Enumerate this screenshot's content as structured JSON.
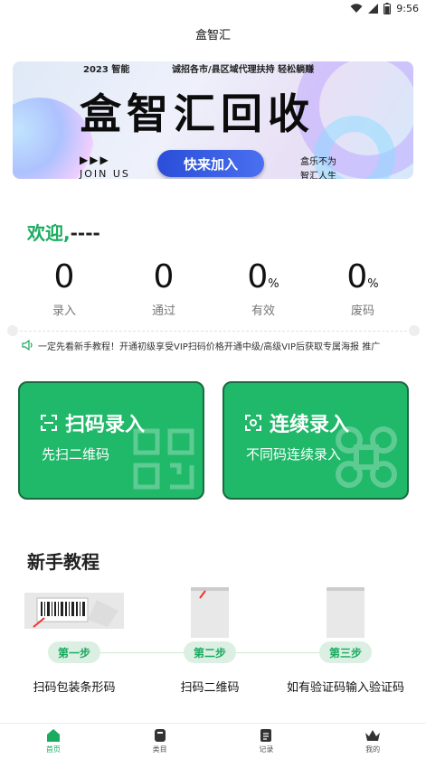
{
  "status": {
    "time": "9:56"
  },
  "header": {
    "title": "盒智汇"
  },
  "banner": {
    "year": "2023",
    "brand_small": "智能",
    "slogan": "诚招各市/县区域代理扶持  轻松躺赚",
    "big_title": "盒智汇回收",
    "arrows": "▶▶▶",
    "join_us": "JOIN US",
    "join_button": "快来加入",
    "side_line1": "盒乐不为",
    "side_line2": "智汇人生"
  },
  "welcome": {
    "greeting": "欢迎,",
    "username": "----"
  },
  "stats": [
    {
      "value": "0",
      "unit": "",
      "label": "录入"
    },
    {
      "value": "0",
      "unit": "",
      "label": "通过"
    },
    {
      "value": "0",
      "unit": "%",
      "label": "有效"
    },
    {
      "value": "0",
      "unit": "%",
      "label": "废码"
    }
  ],
  "notice": {
    "text": "一定先看新手教程！开通初级享受VIP扫码价格开通中级/高级VIP后获取专属海报 推广"
  },
  "actions": {
    "scan": {
      "title": "扫码录入",
      "subtitle": "先扫二维码"
    },
    "continuous": {
      "title": "连续录入",
      "subtitle": "不同码连续录入"
    }
  },
  "tutorial": {
    "title": "新手教程",
    "steps": [
      {
        "badge": "第一步",
        "caption": "扫码包装条形码"
      },
      {
        "badge": "第二步",
        "caption": "扫码二维码"
      },
      {
        "badge": "第三步",
        "caption": "如有验证码输入验证码"
      }
    ]
  },
  "nav": [
    {
      "label": "首页",
      "icon": "home-icon",
      "active": true
    },
    {
      "label": "类目",
      "icon": "category-icon",
      "active": false
    },
    {
      "label": "记录",
      "icon": "record-icon",
      "active": false
    },
    {
      "label": "我的",
      "icon": "crown-icon",
      "active": false
    }
  ],
  "colors": {
    "primary": "#20b869",
    "primary_dark": "#1b6a41",
    "welcome": "#1aab60"
  }
}
